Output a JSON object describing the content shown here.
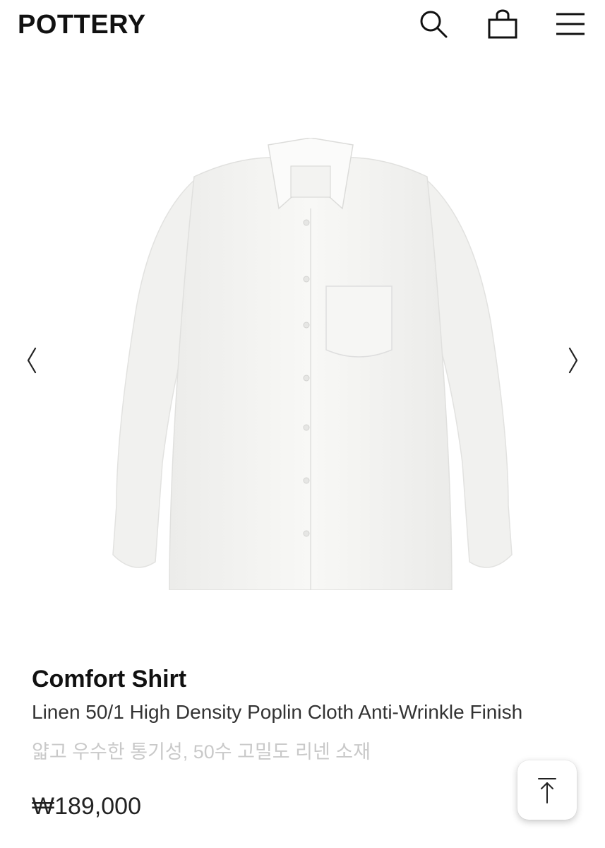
{
  "header": {
    "logo": "POTTERY",
    "icons": [
      "search-icon",
      "shopping-bag-icon",
      "menu-icon"
    ]
  },
  "gallery": {
    "prev_icon": "chevron-left-icon",
    "next_icon": "chevron-right-icon",
    "image_alt": "Comfort Shirt"
  },
  "product": {
    "title": "Comfort Shirt",
    "subtitle": "Linen 50/1 High Density Poplin Cloth Anti-Wrinkle Finish",
    "description": "얇고 우수한 통기성, 50수 고밀도 리넨 소재",
    "price": "₩189,000"
  },
  "scroll_top": {
    "icon": "arrow-up-to-top-icon"
  }
}
